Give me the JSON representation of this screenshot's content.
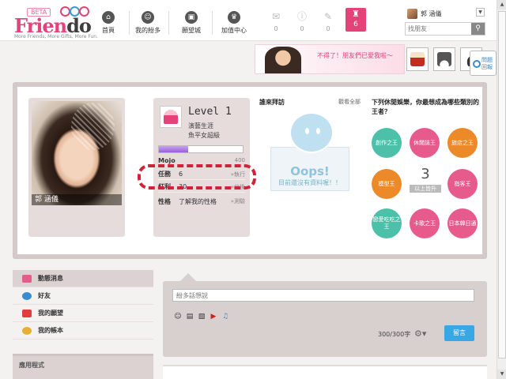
{
  "logo": {
    "beta": "BETA",
    "name_a": "Frien",
    "name_b": "do",
    "tagline": "More Friends, More Gifts, More Fun."
  },
  "nav": [
    {
      "label": "首頁",
      "icon": "home-icon"
    },
    {
      "label": "我的紛多",
      "icon": "person-icon"
    },
    {
      "label": "願望城",
      "icon": "gift-icon"
    },
    {
      "label": "加值中心",
      "icon": "crown-icon"
    }
  ],
  "notifications": [
    {
      "icon": "mail-icon",
      "count": "0"
    },
    {
      "icon": "info-icon",
      "count": "0"
    },
    {
      "icon": "chat-icon",
      "count": "0"
    }
  ],
  "trophy": {
    "icon": "trophy-icon",
    "count": "6"
  },
  "user": {
    "name": "郭 涵儀"
  },
  "search": {
    "placeholder": "找朋友"
  },
  "banner": {
    "text": "不得了！朋友們已愛我啦～"
  },
  "help": {
    "label_1": "問題",
    "label_2": "回報"
  },
  "profile": {
    "name": "郭 涵儀"
  },
  "stats": {
    "level": "Level 1",
    "title_1": "演藝生涯",
    "title_2": "魚平女超級",
    "mojo_label": "Mojo",
    "mojo_value": "400",
    "mojo_progress": 0.35,
    "rows": [
      {
        "key": "任務",
        "value": "6",
        "action": "»執行"
      },
      {
        "key": "紅利",
        "value": "30",
        "action": "»兌換"
      },
      {
        "key": "性格",
        "value": "了解我的性格",
        "action": "»測驗"
      }
    ]
  },
  "visitors": {
    "title": "誰來拜訪",
    "view_all": "觀看全部",
    "oops": "Oops!",
    "message": "目前還沒有資料喔！！"
  },
  "kings": {
    "title": "下列休閒娛樂，你最想成為哪些類別的王者？",
    "count": "3",
    "upgrade": "以上皆升",
    "items": [
      {
        "label": "創作之王",
        "color": "#4cc0a8"
      },
      {
        "label": "休閒誌王",
        "color": "#e65a8c"
      },
      {
        "label": "旅店之王",
        "color": "#ec8a2a"
      },
      {
        "label": "模型王",
        "color": "#ec8a2a"
      },
      {
        "label": "指客王",
        "color": "#e65a8c"
      },
      {
        "label": "戀愛吃吃之王",
        "color": "#4cc0a8"
      },
      {
        "label": "卡歌之王",
        "color": "#e65a8c"
      },
      {
        "label": "日本韓日通",
        "color": "#e65a8c"
      }
    ]
  },
  "sidebar": {
    "items": [
      {
        "label": "動態消息",
        "color": "#e65a8c"
      },
      {
        "label": "好友",
        "color": "#3a8bd0"
      },
      {
        "label": "我的願望",
        "color": "#e23c3c"
      },
      {
        "label": "我的帳本",
        "color": "#e8b030"
      }
    ],
    "footer": "應用程式"
  },
  "post": {
    "placeholder": "紛多話想說",
    "count": "300/300字",
    "send": "留言"
  }
}
